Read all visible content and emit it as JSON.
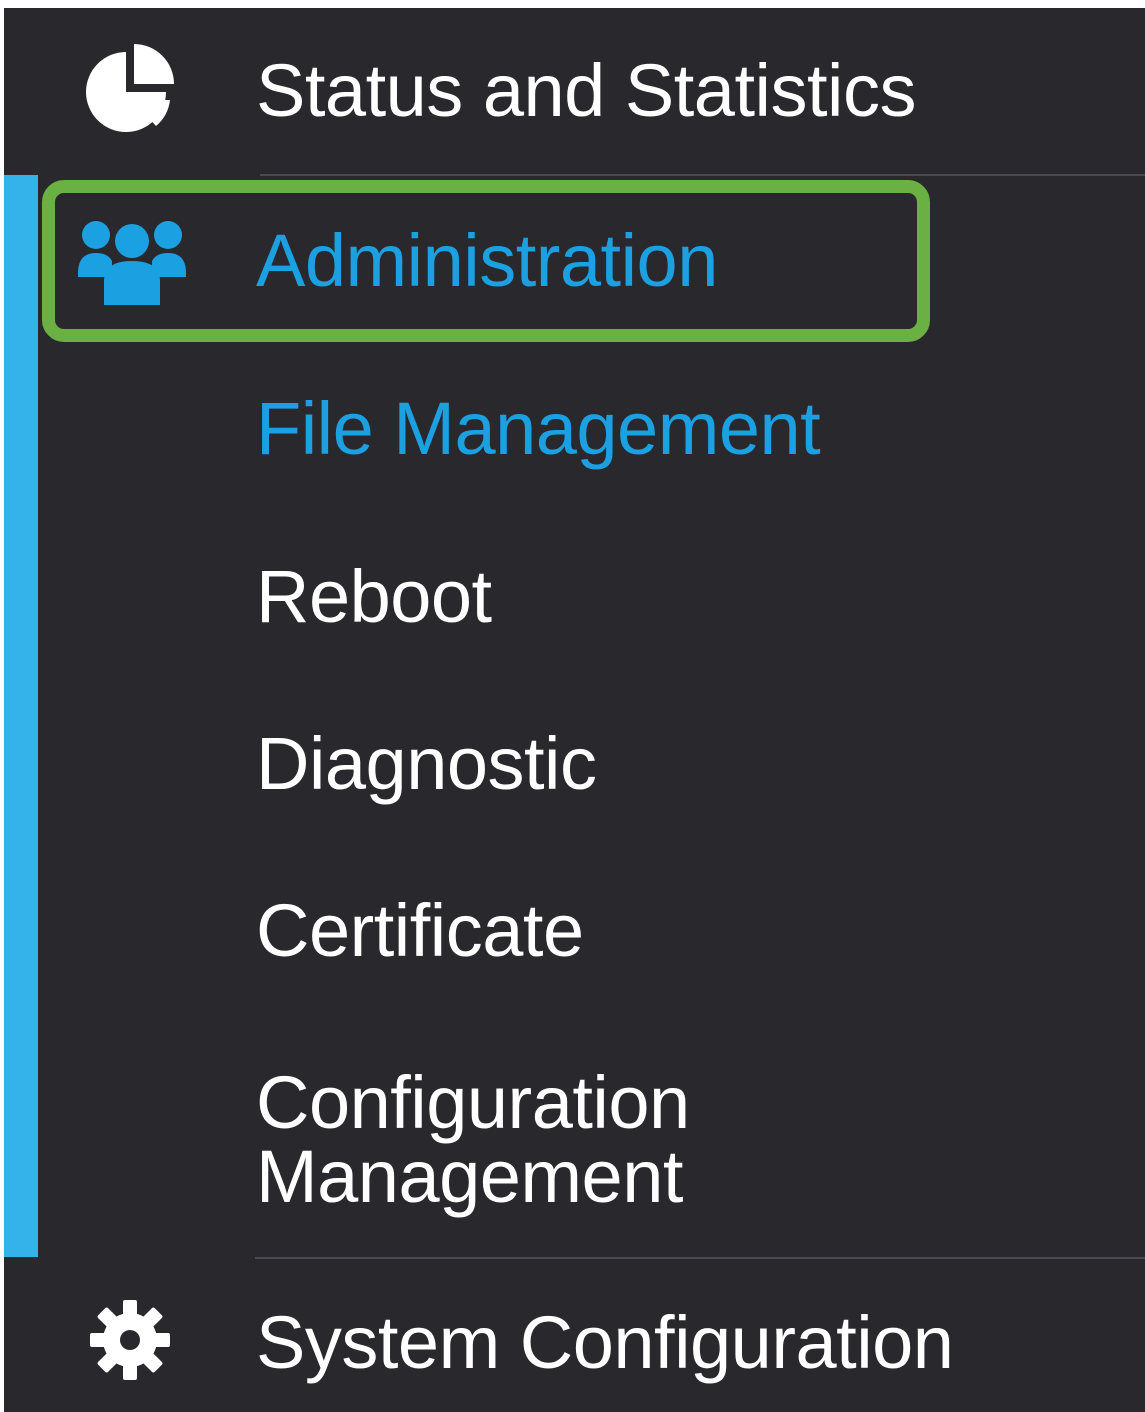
{
  "colors": {
    "background": "#29282d",
    "text": "#ffffff",
    "active": "#1ba0e1",
    "accent_bar": "#33b3ea",
    "highlight": "#6ab043"
  },
  "nav": {
    "status": {
      "label": "Status and Statistics",
      "icon": "pie-chart-icon"
    },
    "administration": {
      "label": "Administration",
      "icon": "users-icon",
      "items": [
        "File Management",
        "Reboot",
        "Diagnostic",
        "Certificate",
        "Configuration Management"
      ]
    },
    "system": {
      "label": "System Configuration",
      "icon": "gear-icon"
    }
  }
}
